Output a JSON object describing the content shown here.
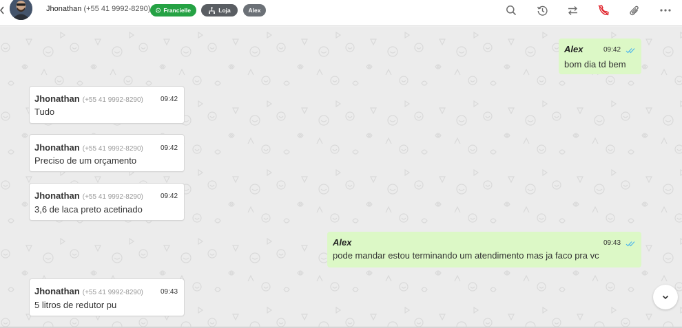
{
  "header": {
    "contact_name": "Jhonathan",
    "contact_phone": "(+55 41 9992-8290)",
    "tags": [
      {
        "label": "Francielle",
        "icon": "whatsapp-icon",
        "color": "#25a244"
      },
      {
        "label": "Loja",
        "icon": "store-icon",
        "color": "#5a5e63"
      },
      {
        "label": "Alex",
        "icon": "",
        "color": "#6c7177"
      }
    ],
    "actions": [
      "search-icon",
      "history-icon",
      "transfer-icon",
      "end-call-icon",
      "attach-icon",
      "more-icon"
    ]
  },
  "messages": [
    {
      "direction": "out",
      "sender": "Alex",
      "time": "09:42",
      "text": "bom dia td bem",
      "status": "read"
    },
    {
      "direction": "in",
      "sender": "Jhonathan",
      "phone": "(+55 41 9992-8290)",
      "time": "09:42",
      "text": "Tudo"
    },
    {
      "direction": "in",
      "sender": "Jhonathan",
      "phone": "(+55 41 9992-8290)",
      "time": "09:42",
      "text": "Preciso de um orçamento"
    },
    {
      "direction": "in",
      "sender": "Jhonathan",
      "phone": "(+55 41 9992-8290)",
      "time": "09:42",
      "text": "3,6 de laca preto acetinado"
    },
    {
      "direction": "out",
      "sender": "Alex",
      "time": "09:43",
      "text": "pode mandar estou terminando um atendimento mas ja faco pra vc",
      "status": "read"
    },
    {
      "direction": "in",
      "sender": "Jhonathan",
      "phone": "(+55 41 9992-8290)",
      "time": "09:43",
      "text": "5 litros de redutor pu"
    }
  ],
  "colors": {
    "outgoing_bubble": "#dcf8c6",
    "incoming_bubble": "#ffffff",
    "read_ticks": "#4fb6ec",
    "end_call": "#e0232b"
  }
}
